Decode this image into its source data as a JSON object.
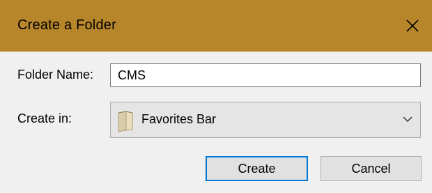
{
  "dialog": {
    "title": "Create a Folder",
    "close_icon": "close-icon",
    "colors": {
      "titlebar": "#b8862a",
      "default_button_border": "#0078d7"
    }
  },
  "form": {
    "folder_name_label": "Folder Name:",
    "folder_name_value": "CMS",
    "create_in_label": "Create in:",
    "create_in_selected": "Favorites Bar",
    "create_in_icon": "folder-icon",
    "dropdown_icon": "chevron-down-icon"
  },
  "buttons": {
    "create_label": "Create",
    "cancel_label": "Cancel"
  }
}
